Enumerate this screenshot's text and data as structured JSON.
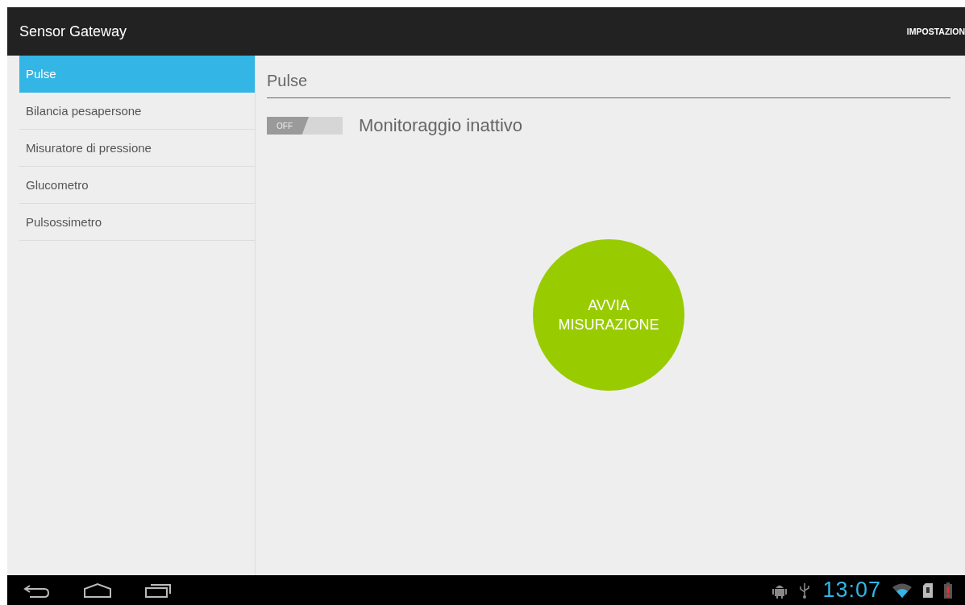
{
  "action_bar": {
    "title": "Sensor Gateway",
    "action": "IMPOSTAZION"
  },
  "sidebar": {
    "items": [
      {
        "label": "Pulse",
        "selected": true
      },
      {
        "label": "Bilancia pesapersone",
        "selected": false
      },
      {
        "label": "Misuratore di pressione",
        "selected": false
      },
      {
        "label": "Glucometro",
        "selected": false
      },
      {
        "label": "Pulsossimetro",
        "selected": false
      }
    ]
  },
  "detail": {
    "title": "Pulse",
    "toggle": {
      "label": "OFF",
      "on": false
    },
    "status": "Monitoraggio inattivo",
    "start_button": [
      "AVVIA",
      "MISURAZIONE"
    ]
  },
  "status_bar": {
    "time": "13:07"
  }
}
